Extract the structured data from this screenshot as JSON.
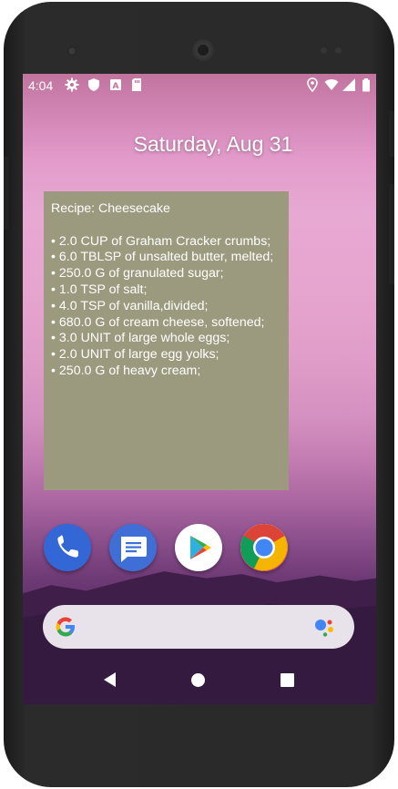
{
  "status_bar": {
    "time": "4:04",
    "left_icons": [
      "settings-gear-icon",
      "shield-icon",
      "a-box-icon",
      "sd-card-icon"
    ],
    "right_icons": [
      "location-icon",
      "wifi-icon",
      "signal-icon",
      "battery-icon"
    ]
  },
  "lock_date": "Saturday, Aug 31",
  "widget": {
    "title": "Recipe: Cheesecake",
    "ingredients": [
      "• 2.0 CUP of Graham Cracker crumbs;",
      "• 6.0 TBLSP of unsalted butter, melted;",
      "• 250.0 G of granulated sugar;",
      "• 1.0 TSP of salt;",
      "• 4.0 TSP of vanilla,divided;",
      "• 680.0 G of cream cheese, softened;",
      "• 3.0 UNIT of large whole eggs;",
      "• 2.0 UNIT of large egg yolks;",
      "• 250.0 G of heavy cream;"
    ],
    "background_color": "#9c9a7e"
  },
  "dock_apps": [
    "phone-icon",
    "messages-icon",
    "play-store-icon",
    "chrome-icon"
  ],
  "search_bar": {
    "logo": "google-g-icon",
    "assistant": "google-assistant-icon"
  },
  "nav_bar": [
    "back-icon",
    "home-icon",
    "recents-icon"
  ]
}
